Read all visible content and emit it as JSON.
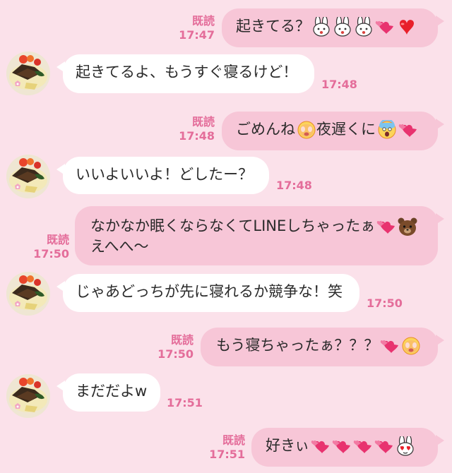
{
  "colors": {
    "background": "#fbe1ea",
    "outgoing_bubble": "#f7c6d7",
    "incoming_bubble": "#ffffff",
    "meta_text": "#e46d9a"
  },
  "messages": [
    {
      "id": 1,
      "side": "out",
      "text": "起きてる？",
      "read": "既読",
      "time": "17:47",
      "emojis": [
        "bunny-shocked",
        "bunny-laugh",
        "bunny-kiss",
        "hearts-pink",
        "heart-red"
      ]
    },
    {
      "id": 2,
      "side": "in",
      "text": "起きてるよ、もうすぐ寝るけど！",
      "time": "17:48"
    },
    {
      "id": 3,
      "side": "out",
      "text": "ごめんね",
      "text2": "夜遅くに",
      "read": "既読",
      "time": "17:48",
      "emojis": [
        "crying-face",
        "screaming-face",
        "hearts-pink"
      ]
    },
    {
      "id": 4,
      "side": "in",
      "text": "いいよいいよ！どしたー？",
      "time": "17:48"
    },
    {
      "id": 5,
      "side": "out",
      "text": "なかなか眠くならなくてLINEしちゃったぁ",
      "text_line2": "えへへ〜",
      "read": "既読",
      "time": "17:50",
      "emojis": [
        "hearts-pink",
        "bear-face"
      ]
    },
    {
      "id": 6,
      "side": "in",
      "text": "じゃあどっちが先に寝れるか競争な！笑",
      "time": "17:50"
    },
    {
      "id": 7,
      "side": "out",
      "text": "もう寝ちゃったぁ？？？",
      "read": "既読",
      "time": "17:50",
      "emojis": [
        "hearts-pink",
        "crying-face"
      ]
    },
    {
      "id": 8,
      "side": "in",
      "text": "まだだよw",
      "time": "17:51"
    },
    {
      "id": 9,
      "side": "out",
      "text": "好きぃ",
      "read": "既読",
      "time": "17:51",
      "emojis": [
        "hearts-pink",
        "hearts-pink",
        "hearts-pink",
        "hearts-pink",
        "bunny-heart-eyes"
      ]
    }
  ]
}
